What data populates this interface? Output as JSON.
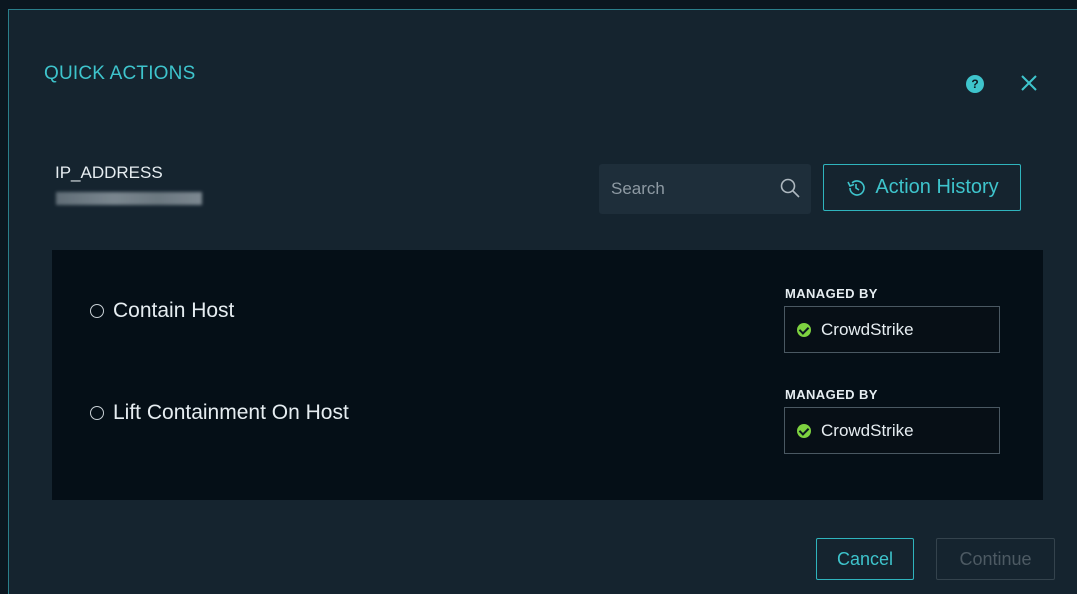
{
  "dialog": {
    "title": "QUICK ACTIONS",
    "help_glyph": "?",
    "help_icon": "help-circle-icon",
    "close_icon": "close-icon"
  },
  "target": {
    "label": "IP_ADDRESS"
  },
  "search": {
    "placeholder": "Search",
    "value": ""
  },
  "toolbar": {
    "history_label": "Action History"
  },
  "actions": [
    {
      "label": "Contain Host",
      "managed_by_label": "MANAGED BY",
      "managed_by": "CrowdStrike",
      "status": "connected"
    },
    {
      "label": "Lift Containment On Host",
      "managed_by_label": "MANAGED BY",
      "managed_by": "CrowdStrike",
      "status": "connected"
    }
  ],
  "footer": {
    "cancel_label": "Cancel",
    "continue_label": "Continue",
    "continue_enabled": false
  },
  "colors": {
    "accent": "#3ec4cc",
    "background": "#15242f",
    "panel": "#050f17",
    "success": "#7ed240",
    "disabled": "#4d5a63"
  }
}
